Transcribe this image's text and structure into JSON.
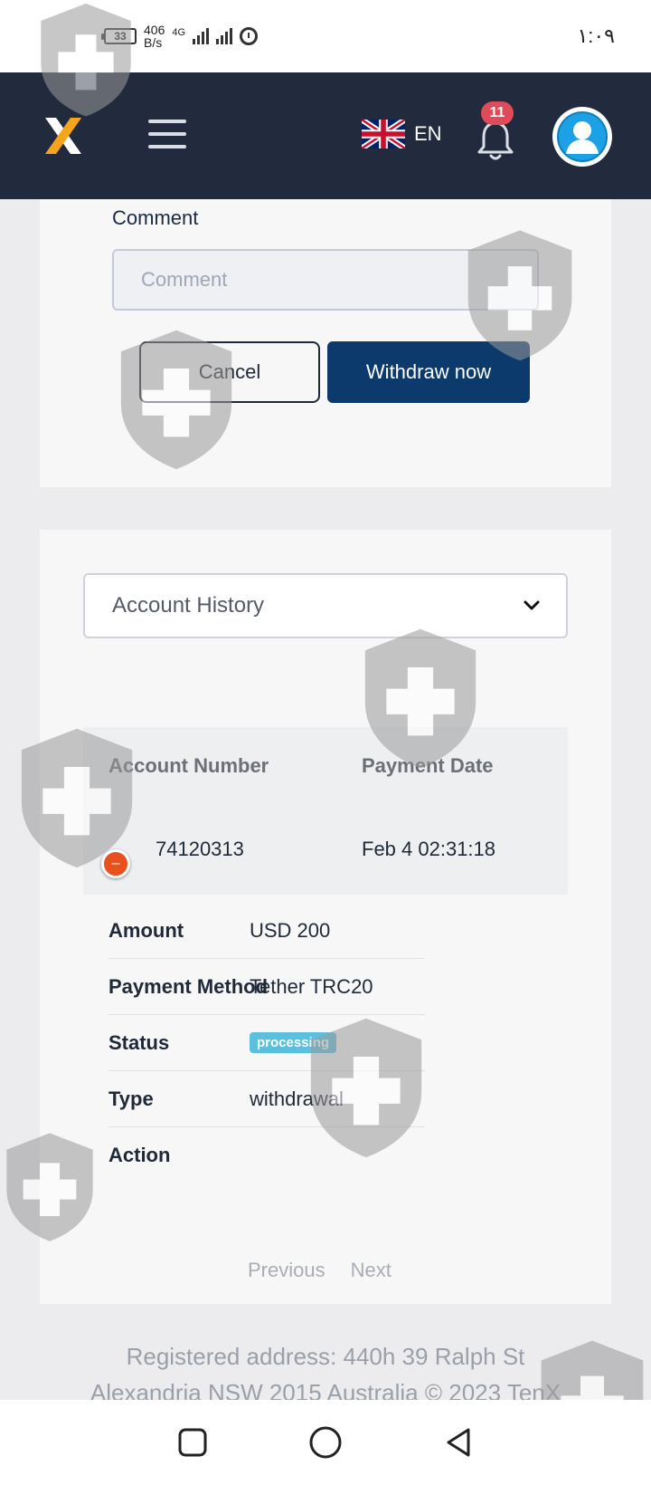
{
  "status_bar": {
    "battery": "33",
    "speed_value": "406",
    "speed_unit": "B/s",
    "network": "4G",
    "time": "١:٠٩"
  },
  "header": {
    "logo_letter": "X",
    "language": "EN",
    "notifications_count": "11",
    "colors": {
      "background": "#222b3d",
      "badge": "#e04b5a"
    }
  },
  "withdraw_form": {
    "comment_label": "Comment",
    "comment_placeholder": "Comment",
    "comment_value": "",
    "cancel_label": "Cancel",
    "withdraw_label": "Withdraw now",
    "colors": {
      "primary": "#0c3a6c"
    }
  },
  "history": {
    "select_value": "Account History",
    "columns": [
      "Account Number",
      "Payment Date"
    ],
    "rows": [
      {
        "account_number": "74120313",
        "payment_date": "Feb 4 02:31:18"
      }
    ],
    "details": [
      {
        "key": "Amount",
        "value": "USD 200"
      },
      {
        "key": "Payment Method",
        "value": "Tether TRC20"
      },
      {
        "key": "Status",
        "value": "processing"
      },
      {
        "key": "Type",
        "value": "withdrawal"
      },
      {
        "key": "Action",
        "value": ""
      }
    ],
    "pagination": {
      "previous": "Previous",
      "next": "Next"
    },
    "colors": {
      "status_processing": "#5bc0de",
      "toggle": "#e8501d"
    }
  },
  "footer": {
    "line1": "Registered address: 440h 39 Ralph St",
    "line2": "Alexandria NSW 2015 Australia © 2023 TenX"
  },
  "nav_bar": {
    "icons": [
      "recent-apps-icon",
      "home-icon",
      "back-icon"
    ]
  }
}
